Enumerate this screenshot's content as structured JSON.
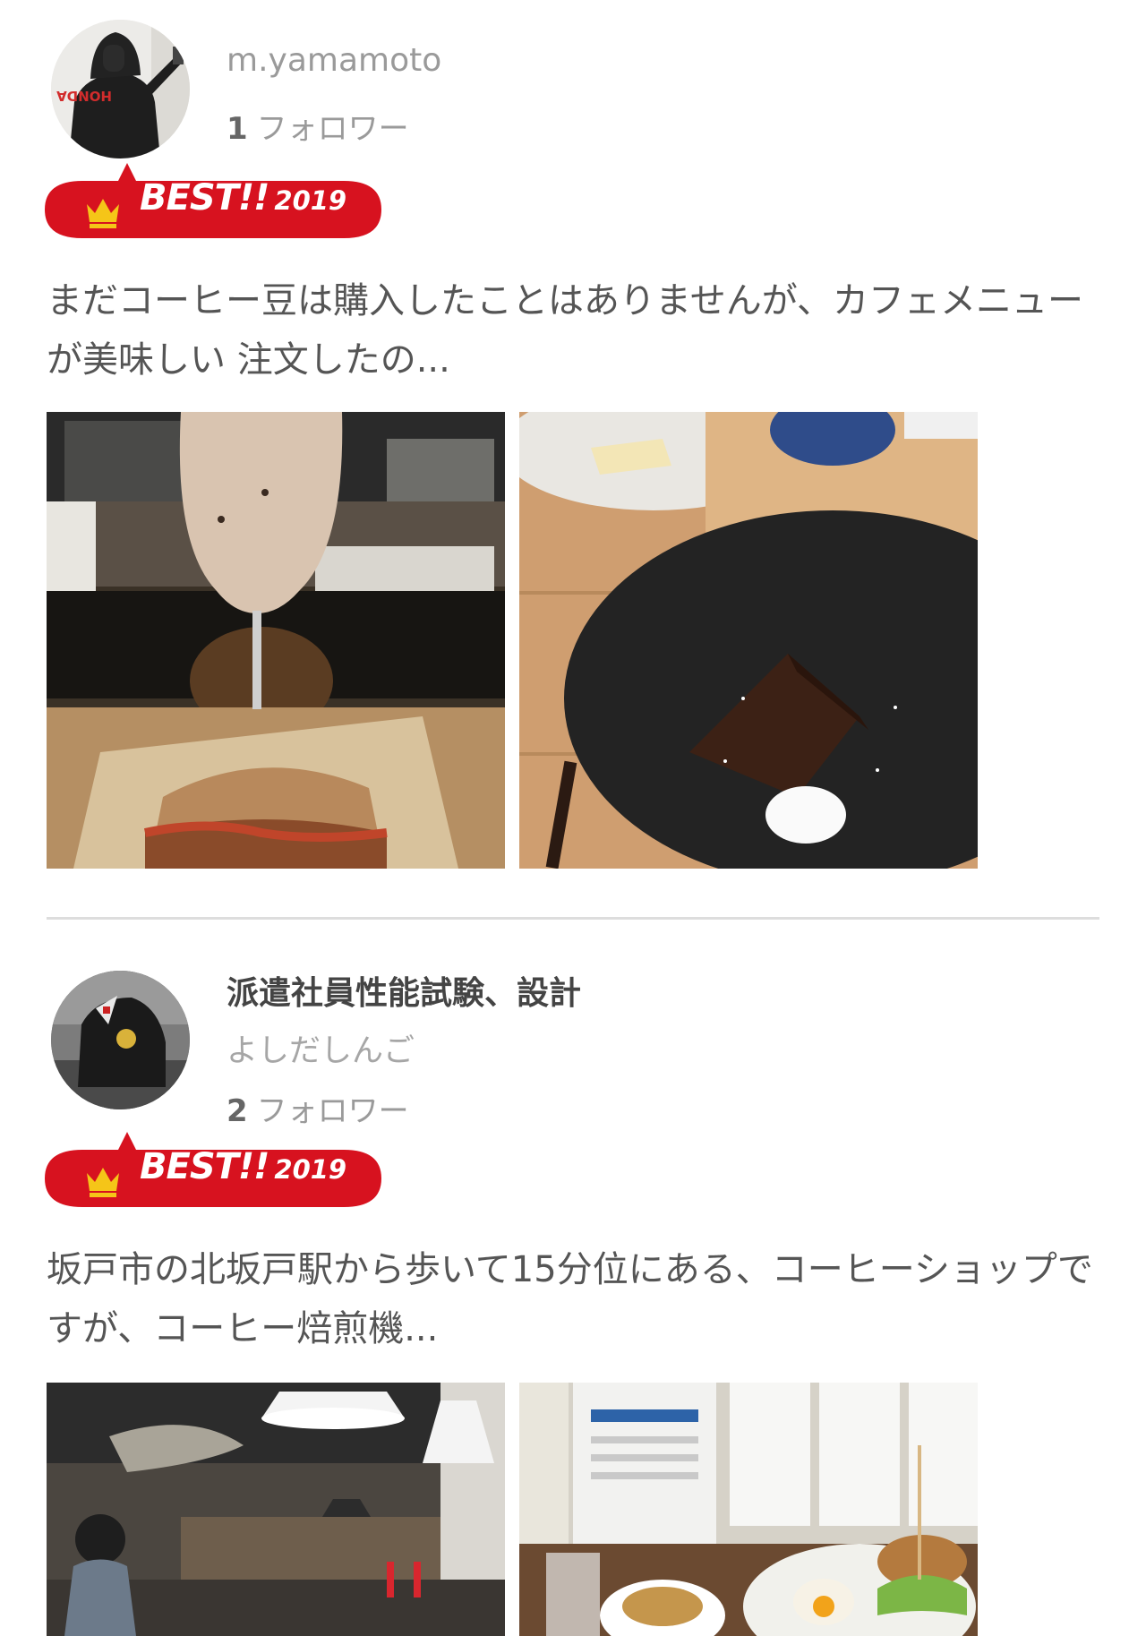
{
  "reviews": [
    {
      "user_name": "m.yamamoto",
      "follower_count": "1",
      "follower_label": "フォロワー",
      "badge": {
        "label": "BEST!!",
        "year": "2019"
      },
      "comment": "まだコーヒー豆は購入したことはありませんが、カフェメニューが美味しい 注文したの..."
    },
    {
      "user_title": "派遣社員性能試験、設計",
      "user_name": "よしだしんご",
      "follower_count": "2",
      "follower_label": "フォロワー",
      "badge": {
        "label": "BEST!!",
        "year": "2019"
      },
      "comment": "坂戸市の北坂戸駅から歩いて15分位にある、コーヒーショップですが、コーヒー焙煎機..."
    }
  ],
  "colors": {
    "badge_red": "#d7121f",
    "badge_crown": "#f5c518",
    "divider": "#dddddd"
  },
  "icons": {
    "badge": "crown-icon"
  }
}
